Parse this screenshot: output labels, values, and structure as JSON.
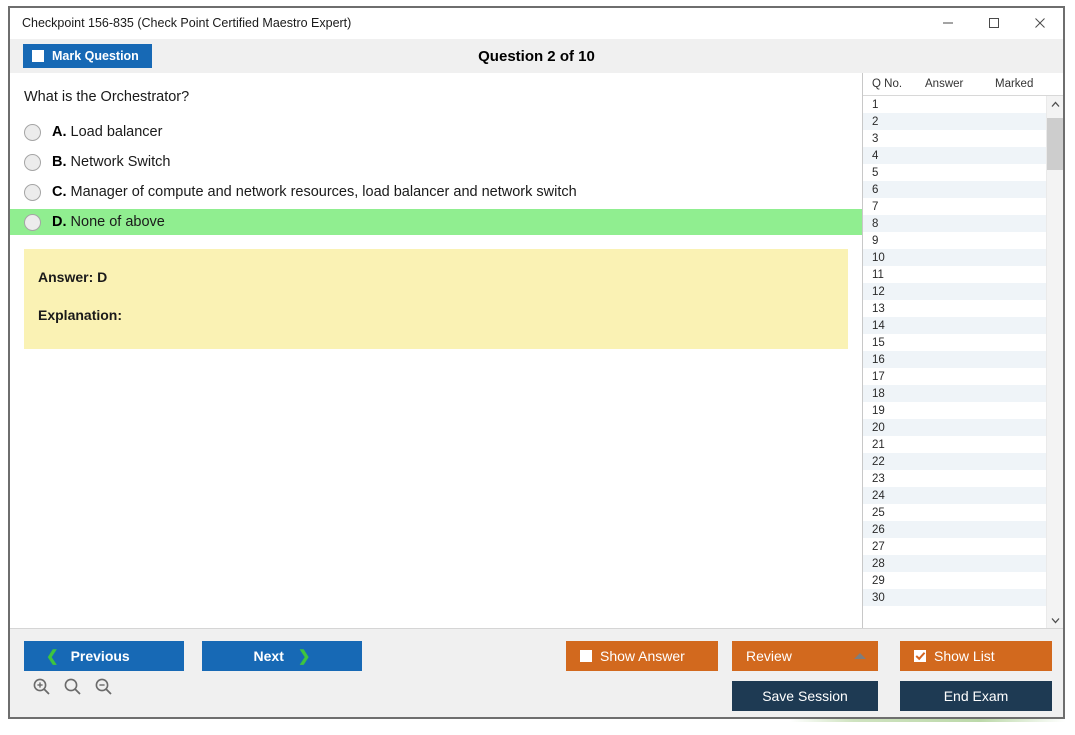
{
  "window": {
    "title": "Checkpoint 156-835 (Check Point Certified Maestro Expert)",
    "controls": {
      "minimize": "minimize-icon",
      "maximize": "maximize-icon",
      "close": "close-icon"
    }
  },
  "toolbar": {
    "mark_question_label": "Mark Question",
    "mark_question_checked": false,
    "question_counter": "Question 2 of 10"
  },
  "question": {
    "text": "What is the Orchestrator?",
    "options": [
      {
        "letter": "A.",
        "text": "Load balancer",
        "highlighted": false,
        "selected": false
      },
      {
        "letter": "B.",
        "text": "Network Switch",
        "highlighted": false,
        "selected": false
      },
      {
        "letter": "C.",
        "text": "Manager of compute and network resources, load balancer and network switch",
        "highlighted": false,
        "selected": false
      },
      {
        "letter": "D.",
        "text": "None of above",
        "highlighted": true,
        "selected": false
      }
    ]
  },
  "answer_panel": {
    "answer_line": "Answer: D",
    "explanation_line": "Explanation:",
    "background_color": "#faf2b4"
  },
  "question_list": {
    "headers": {
      "number": "Q No.",
      "answer": "Answer",
      "marked": "Marked"
    },
    "rows": [
      {
        "no": "1",
        "answer": "",
        "marked": ""
      },
      {
        "no": "2",
        "answer": "",
        "marked": ""
      },
      {
        "no": "3",
        "answer": "",
        "marked": ""
      },
      {
        "no": "4",
        "answer": "",
        "marked": ""
      },
      {
        "no": "5",
        "answer": "",
        "marked": ""
      },
      {
        "no": "6",
        "answer": "",
        "marked": ""
      },
      {
        "no": "7",
        "answer": "",
        "marked": ""
      },
      {
        "no": "8",
        "answer": "",
        "marked": ""
      },
      {
        "no": "9",
        "answer": "",
        "marked": ""
      },
      {
        "no": "10",
        "answer": "",
        "marked": ""
      },
      {
        "no": "11",
        "answer": "",
        "marked": ""
      },
      {
        "no": "12",
        "answer": "",
        "marked": ""
      },
      {
        "no": "13",
        "answer": "",
        "marked": ""
      },
      {
        "no": "14",
        "answer": "",
        "marked": ""
      },
      {
        "no": "15",
        "answer": "",
        "marked": ""
      },
      {
        "no": "16",
        "answer": "",
        "marked": ""
      },
      {
        "no": "17",
        "answer": "",
        "marked": ""
      },
      {
        "no": "18",
        "answer": "",
        "marked": ""
      },
      {
        "no": "19",
        "answer": "",
        "marked": ""
      },
      {
        "no": "20",
        "answer": "",
        "marked": ""
      },
      {
        "no": "21",
        "answer": "",
        "marked": ""
      },
      {
        "no": "22",
        "answer": "",
        "marked": ""
      },
      {
        "no": "23",
        "answer": "",
        "marked": ""
      },
      {
        "no": "24",
        "answer": "",
        "marked": ""
      },
      {
        "no": "25",
        "answer": "",
        "marked": ""
      },
      {
        "no": "26",
        "answer": "",
        "marked": ""
      },
      {
        "no": "27",
        "answer": "",
        "marked": ""
      },
      {
        "no": "28",
        "answer": "",
        "marked": ""
      },
      {
        "no": "29",
        "answer": "",
        "marked": ""
      },
      {
        "no": "30",
        "answer": "",
        "marked": ""
      }
    ],
    "scroll_up_icon": "chevron-up-icon",
    "scroll_down_icon": "chevron-down-icon"
  },
  "footer": {
    "previous_label": "Previous",
    "next_label": "Next",
    "show_answer_label": "Show Answer",
    "show_answer_checked": false,
    "review_label": "Review",
    "show_list_label": "Show List",
    "show_list_checked": true,
    "save_session_label": "Save Session",
    "end_exam_label": "End Exam",
    "zoom_in_icon": "zoom-in-icon",
    "zoom_reset_icon": "zoom-icon",
    "zoom_out_icon": "zoom-out-icon"
  },
  "colors": {
    "primary_blue": "#1769b5",
    "accent_orange": "#d2691e",
    "navy": "#1e3a53",
    "highlight_green": "#90ee90",
    "answer_yellow": "#faf2b4"
  }
}
